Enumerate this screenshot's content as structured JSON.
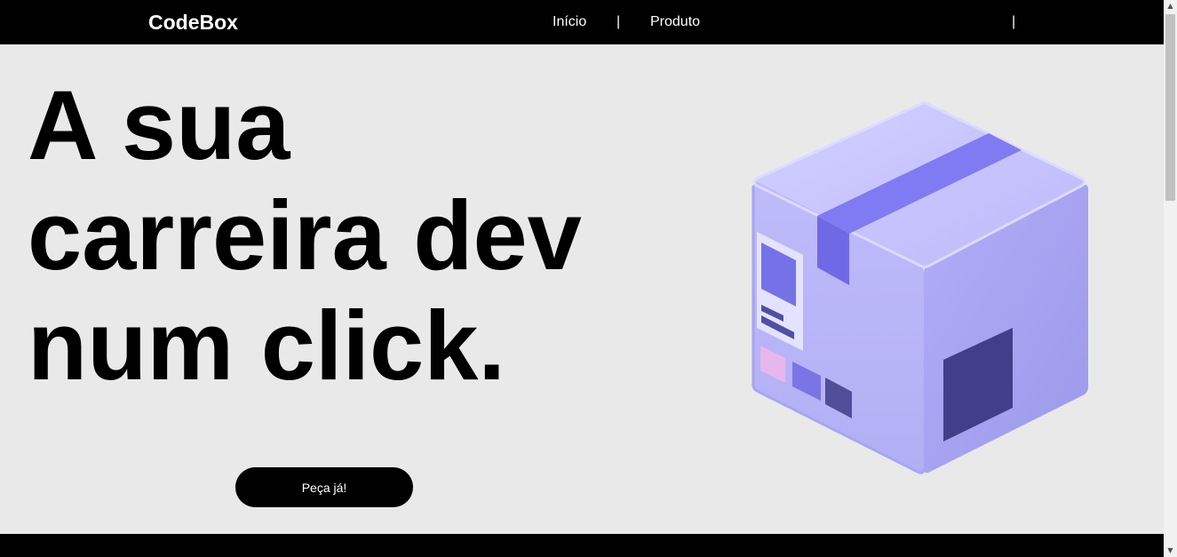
{
  "nav": {
    "brand": "CodeBox",
    "links": [
      "Início",
      "Produto"
    ],
    "separator": "|"
  },
  "hero": {
    "title_lines": [
      "A sua",
      "carreira dev",
      "num click."
    ],
    "cta_label": "Peça já!",
    "illustration": "package-box-icon"
  },
  "colors": {
    "navbar": "#000000",
    "background": "#e9e9e9",
    "box_light": "#c3c1fb",
    "box_tape": "#7b76f0",
    "box_dark": "#423f8a",
    "accent_pink": "#e6b7ec"
  }
}
